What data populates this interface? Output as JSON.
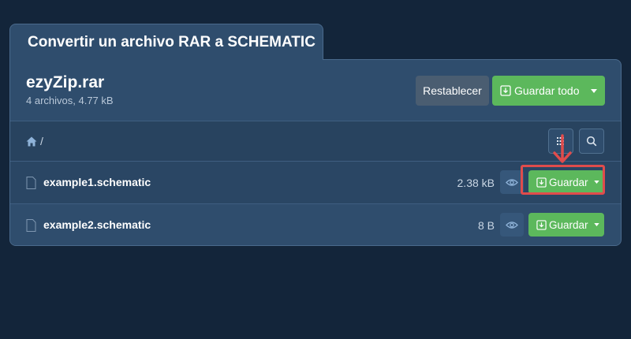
{
  "tab": {
    "title": "Convertir un archivo RAR a SCHEMATIC"
  },
  "archive": {
    "name": "ezyZip.rar",
    "meta": "4 archivos, 4.77 kB",
    "reset_label": "Restablecer",
    "save_all_label": "Guardar todo"
  },
  "breadcrumb": {
    "separator": "/"
  },
  "toolbar": {
    "list_icon": "list-icon",
    "search_icon": "search-icon"
  },
  "files": [
    {
      "name": "example1.schematic",
      "size": "2.38 kB",
      "save_label": "Guardar",
      "icon": "file-icon"
    },
    {
      "name": "example2.schematic",
      "size": "8 B",
      "save_label": "Guardar",
      "icon": "file-icon"
    }
  ],
  "colors": {
    "background": "#13253a",
    "panel": "#2f4d6d",
    "accent_green": "#5cb85c",
    "highlight_red": "#e04c4c"
  }
}
